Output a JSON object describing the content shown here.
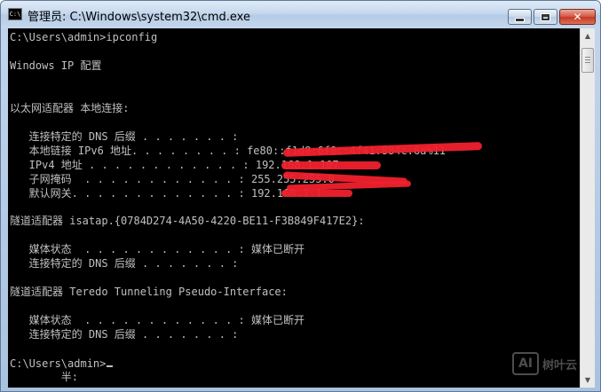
{
  "window": {
    "title": "管理员: C:\\Windows\\system32\\cmd.exe",
    "icon_label": "C:\\",
    "controls": {
      "minimize": "minimize-icon",
      "maximize": "maximize-icon",
      "close": "✕"
    }
  },
  "console": {
    "lines": [
      "C:\\Users\\admin>ipconfig",
      "",
      "Windows IP 配置",
      "",
      "",
      "以太网适配器 本地连接:",
      "",
      "   连接特定的 DNS 后缀 . . . . . . . :",
      "   本地链接 IPv6 地址. . . . . . . . : fe80::f1d8:6f8c:4f41:884c:6a%11",
      "   IPv4 地址 . . . . . . . . . . . . : 192.168.1.107",
      "   子网掩码  . . . . . . . . . . . . : 255.255.255.0",
      "   默认网关. . . . . . . . . . . . . : 192.168.1.1",
      "",
      "隧道适配器 isatap.{0784D274-4A50-4220-BE11-F3B849F417E2}:",
      "",
      "   媒体状态  . . . . . . . . . . . . : 媒体已断开",
      "   连接特定的 DNS 后缀 . . . . . . . :",
      "",
      "隧道适配器 Teredo Tunneling Pseudo-Interface:",
      "",
      "   媒体状态  . . . . . . . . . . . . : 媒体已断开",
      "   连接特定的 DNS 后缀 . . . . . . . :",
      "",
      "C:\\Users\\admin>",
      "        半:"
    ]
  },
  "watermark": {
    "logo": "AI",
    "text": "树叶云"
  },
  "colors": {
    "console_bg": "#000000",
    "console_fg": "#c0c0c0",
    "redaction": "#f0212d"
  }
}
